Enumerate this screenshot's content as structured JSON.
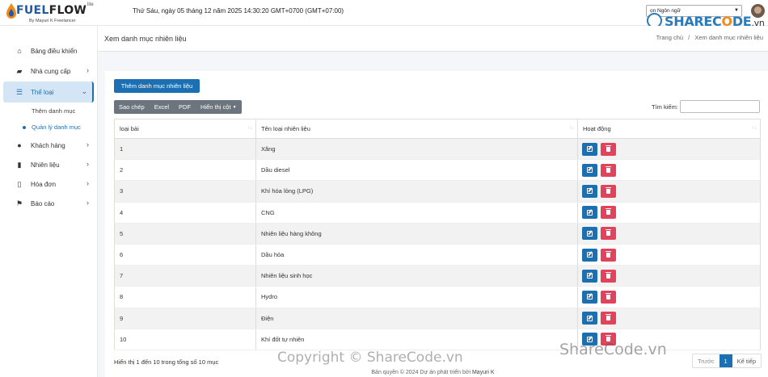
{
  "brand": {
    "name_part1": "FUEL",
    "name_part2": "FLOW",
    "tier": "lite",
    "tagline": "By Mayuri K Freelancer"
  },
  "header": {
    "datetime": "Thứ Sáu, ngày 05 tháng 12 năm 2025 14:30:20 GMT+0700 (GMT+07:00)",
    "language_select": "ọn Ngôn ngữ"
  },
  "watermark": {
    "logo_text_a": "SHAREC",
    "logo_text_o": "O",
    "logo_text_b": "DE",
    "logo_text_vn": ".vn",
    "copyright": "Copyright © ShareCode.vn",
    "corner": "ShareCode.vn"
  },
  "sidebar": {
    "items": [
      {
        "label": "Bảng điều khiển",
        "icon": "home-icon"
      },
      {
        "label": "Nhà cung cấp",
        "icon": "truck-icon"
      },
      {
        "label": "Thể loại",
        "icon": "list-icon"
      },
      {
        "label": "Khách hàng",
        "icon": "user-icon"
      },
      {
        "label": "Nhiên liệu",
        "icon": "fuel-icon"
      },
      {
        "label": "Hóa đơn",
        "icon": "file-icon"
      },
      {
        "label": "Báo cáo",
        "icon": "flag-icon"
      }
    ],
    "sub_items": [
      {
        "label": "Thêm danh mục"
      },
      {
        "label": "Quản lý danh mục"
      }
    ]
  },
  "page": {
    "title": "Xem danh mục nhiên liệu",
    "breadcrumb_home": "Trang chủ",
    "breadcrumb_sep": "/",
    "breadcrumb_current": "Xem danh mục nhiên liệu"
  },
  "toolbar": {
    "add_label": "Thêm danh mục nhiên liệu",
    "copy": "Sao chép",
    "excel": "Excel",
    "pdf": "PDF",
    "columns": "Hiển thị cột"
  },
  "search": {
    "label": "Tìm kiếm:",
    "value": ""
  },
  "table": {
    "headers": [
      "loại bài",
      "Tên loại nhiên liệu",
      "Hoạt động"
    ],
    "rows": [
      {
        "id": "1",
        "name": "Xăng"
      },
      {
        "id": "2",
        "name": "Dầu diesel"
      },
      {
        "id": "3",
        "name": "Khí hóa lỏng (LPG)"
      },
      {
        "id": "4",
        "name": "CNG"
      },
      {
        "id": "5",
        "name": "Nhiên liệu hàng không"
      },
      {
        "id": "6",
        "name": "Dầu hỏa"
      },
      {
        "id": "7",
        "name": "Nhiên liệu sinh học"
      },
      {
        "id": "8",
        "name": "Hydro"
      },
      {
        "id": "9",
        "name": "Điện"
      },
      {
        "id": "10",
        "name": "Khí đốt tự nhiên"
      }
    ]
  },
  "pagination": {
    "info": "Hiển thị 1 đến 10 trong tổng số 10 mục",
    "prev": "Trước",
    "current": "1",
    "next": "Kế tiếp"
  },
  "footer": {
    "text": "Bản quyền © 2024 Dự án phát triển bởi",
    "author": "Mayuri K"
  },
  "colors": {
    "primary": "#1c6fb0",
    "danger": "#e0435b",
    "active_bg": "#d4e6f5",
    "secondary": "#6c757d"
  }
}
